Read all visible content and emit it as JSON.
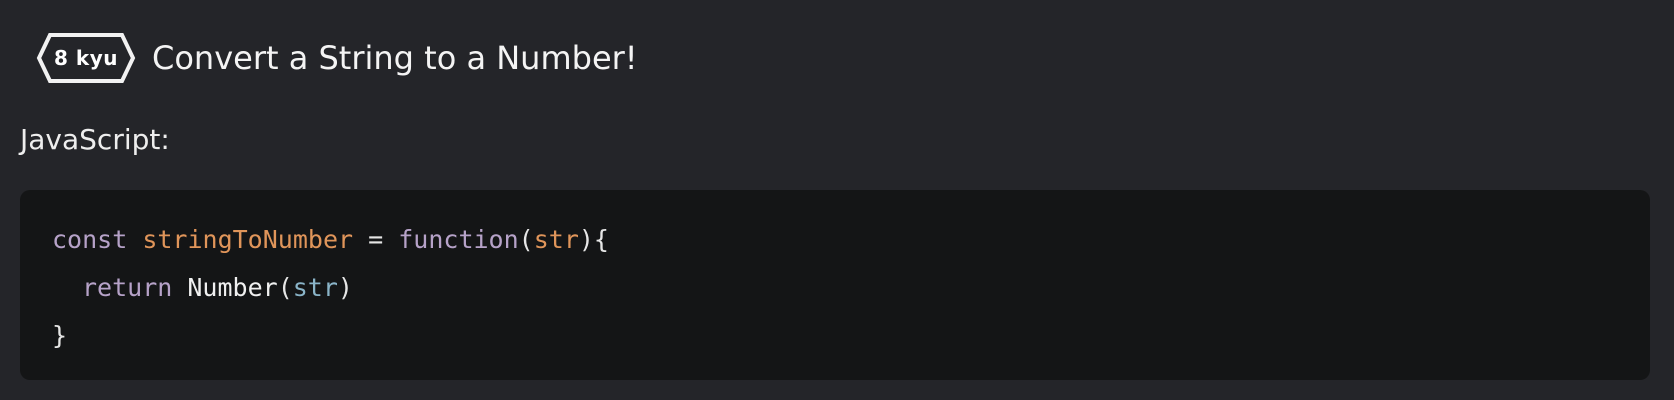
{
  "kata": {
    "rank_label": "8 kyu",
    "title": "Convert a String to a Number!"
  },
  "language": {
    "label": "JavaScript:"
  },
  "code": {
    "line1": {
      "kw_const": "const",
      "fn_name": "stringToNumber",
      "op_assign": "=",
      "kw_function": "function",
      "open_paren": "(",
      "param": "str",
      "close_brace_open": "){"
    },
    "line2": {
      "kw_return": "return",
      "builtin": "Number",
      "open_paren": "(",
      "arg": "str",
      "close_paren": ")"
    },
    "line3": {
      "close_brace": "}"
    }
  },
  "colors": {
    "background": "#242529",
    "code_background": "#141516",
    "keyword": "#b6a2c8",
    "identifier": "#e0955a",
    "variable": "#8ab4c8"
  },
  "icons": {
    "rank_badge": "hexagon-badge-icon"
  }
}
